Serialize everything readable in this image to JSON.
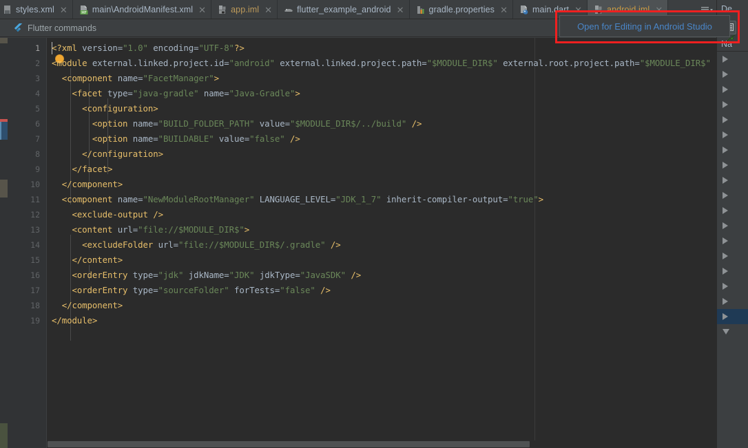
{
  "window": {
    "theme_bg": "#3c3f41",
    "editor_bg": "#2b2b2b",
    "accent": "#4a9fc4",
    "highlight_box_color": "#ef2020"
  },
  "tabs": [
    {
      "label": "styles.xml",
      "icon": "xml-file-icon",
      "close": "✕",
      "selected": false
    },
    {
      "label": "main\\AndroidManifest.xml",
      "icon": "manifest-file-icon",
      "close": "✕",
      "selected": false
    },
    {
      "label": "app.iml",
      "icon": "iml-file-icon",
      "close": "✕",
      "selected": false
    },
    {
      "label": "flutter_example_android",
      "icon": "module-icon",
      "close": "✕",
      "selected": false
    },
    {
      "label": "gradle.properties",
      "icon": "gradle-file-icon",
      "close": "✕",
      "selected": false
    },
    {
      "label": "main.dart",
      "icon": "dart-file-icon",
      "close": "✕",
      "selected": false
    },
    {
      "label": "android.iml",
      "icon": "iml-file-icon",
      "close": "✕",
      "selected": true
    }
  ],
  "flutter_bar": {
    "label": "Flutter commands",
    "icon": "flutter-logo-icon"
  },
  "popup": {
    "link_label": "Open for Editing in Android Studio"
  },
  "editor": {
    "language": "xml",
    "line_numbers": [
      1,
      2,
      3,
      4,
      5,
      6,
      7,
      8,
      9,
      10,
      11,
      12,
      13,
      14,
      15,
      16,
      17,
      18,
      19
    ],
    "active_line": 1,
    "lines": [
      "<?xml version=\"1.0\" encoding=\"UTF-8\"?>",
      "<module external.linked.project.id=\"android\" external.linked.project.path=\"$MODULE_DIR$\" external.root.project.path=\"$MODULE_DIR$\" external.s",
      "  <component name=\"FacetManager\">",
      "    <facet type=\"java-gradle\" name=\"Java-Gradle\">",
      "      <configuration>",
      "        <option name=\"BUILD_FOLDER_PATH\" value=\"$MODULE_DIR$/../build\" />",
      "        <option name=\"BUILDABLE\" value=\"false\" />",
      "      </configuration>",
      "    </facet>",
      "  </component>",
      "  <component name=\"NewModuleRootManager\" LANGUAGE_LEVEL=\"JDK_1_7\" inherit-compiler-output=\"true\">",
      "    <exclude-output />",
      "    <content url=\"file://$MODULE_DIR$\">",
      "      <excludeFolder url=\"file://$MODULE_DIR$/.gradle\" />",
      "    </content>",
      "    <orderEntry type=\"jdk\" jdkName=\"JDK\" jdkType=\"JavaSDK\" />",
      "    <orderEntry type=\"sourceFolder\" forTests=\"false\" />",
      "  </component>",
      "</module>"
    ],
    "horizontal_scroll_percent": 0
  },
  "right_panel": {
    "title": "De",
    "column_header": "Na",
    "toolbar_icon": "panel-layout-icon",
    "rows": 19,
    "selected_row_index": 17,
    "row_icon": "expand-triangle-icon",
    "last_row_icon": "collapse-triangle-icon"
  }
}
